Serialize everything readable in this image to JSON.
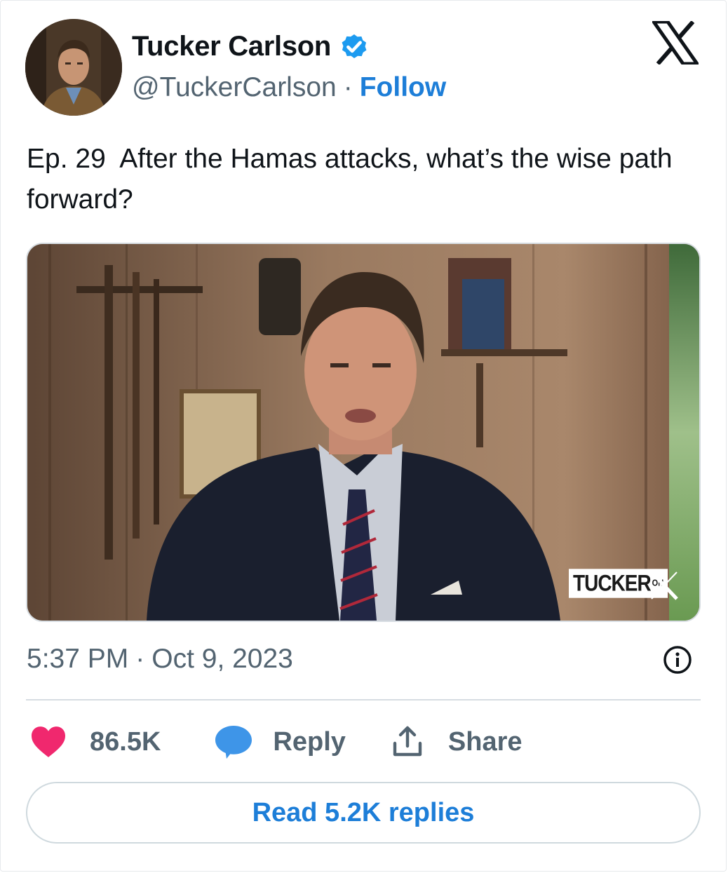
{
  "author": {
    "name": "Tucker Carlson",
    "handle": "@TuckerCarlson",
    "separator": "·",
    "follow_label": "Follow",
    "verified_color": "#1d9bf0"
  },
  "tweet": {
    "text": "Ep. 29  After the Hamas attacks, what’s the wise path forward?"
  },
  "media": {
    "watermark_main": "TUCKER",
    "watermark_on": "ON"
  },
  "meta": {
    "time": "5:37 PM",
    "separator": "·",
    "date": "Oct 9, 2023"
  },
  "actions": {
    "like_count": "86.5K",
    "reply_label": "Reply",
    "share_label": "Share"
  },
  "read_replies_label": "Read 5.2K replies",
  "colors": {
    "accent": "#1d7ed8",
    "like": "#f0286e",
    "reply_bubble": "#3e95e8",
    "muted": "#536471"
  },
  "icons": [
    "verified-badge-icon",
    "x-logo-icon",
    "info-icon",
    "heart-icon",
    "reply-bubble-icon",
    "share-icon"
  ]
}
